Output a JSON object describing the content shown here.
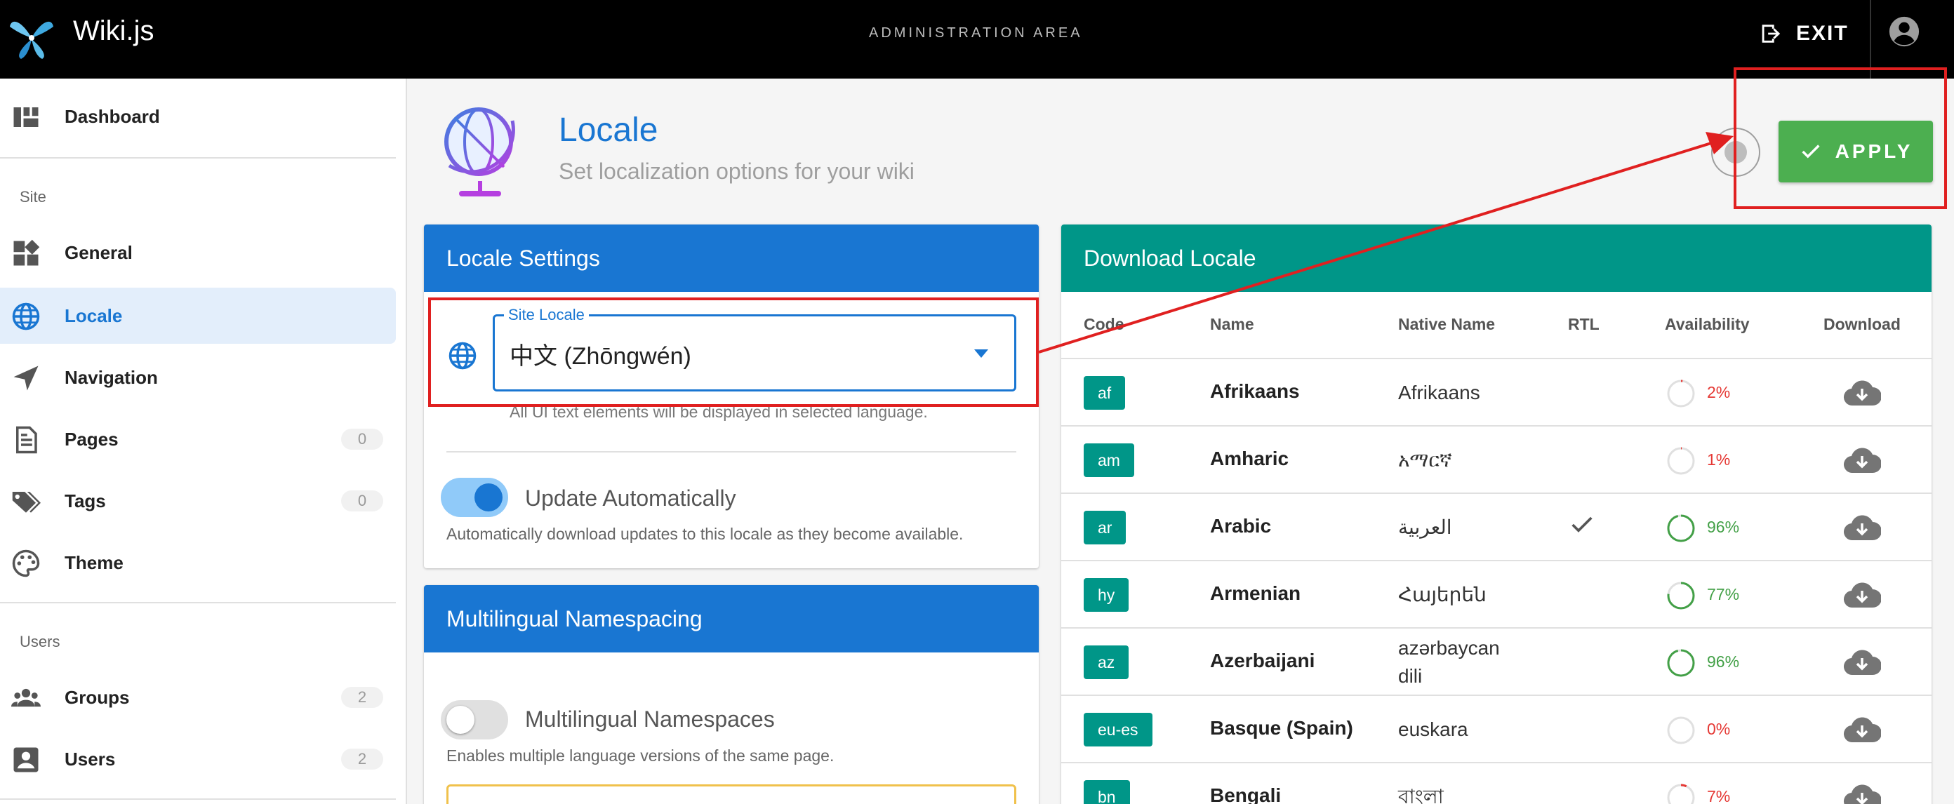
{
  "topbar": {
    "brand": "Wiki.js",
    "area": "ADMINISTRATION AREA",
    "exit_label": "EXIT"
  },
  "sidebar": {
    "dashboard": "Dashboard",
    "section_site": "Site",
    "general": "General",
    "locale": "Locale",
    "navigation": "Navigation",
    "pages": "Pages",
    "pages_count": "0",
    "tags": "Tags",
    "tags_count": "0",
    "theme": "Theme",
    "section_users": "Users",
    "groups": "Groups",
    "groups_count": "2",
    "users": "Users",
    "users_count": "2"
  },
  "header": {
    "title": "Locale",
    "subtitle": "Set localization options for your wiki",
    "apply_label": "APPLY"
  },
  "locale_settings": {
    "title": "Locale Settings",
    "site_locale_label": "Site Locale",
    "site_locale_value": "中文 (Zhōngwén)",
    "site_locale_hint": "All UI text elements will be displayed in selected language.",
    "update_label": "Update Automatically",
    "update_hint": "Automatically download updates to this locale as they become available."
  },
  "namespacing": {
    "title": "Multilingual Namespacing",
    "toggle_label": "Multilingual Namespaces",
    "toggle_hint": "Enables multiple language versions of the same page."
  },
  "download": {
    "title": "Download Locale",
    "columns": [
      "Code",
      "Name",
      "Native Name",
      "RTL",
      "Availability",
      "Download"
    ],
    "rows": [
      {
        "code": "af",
        "name": "Afrikaans",
        "native": "Afrikaans",
        "rtl": false,
        "availability": "2%",
        "level": 0.02
      },
      {
        "code": "am",
        "name": "Amharic",
        "native": "አማርኛ",
        "rtl": false,
        "availability": "1%",
        "level": 0.01
      },
      {
        "code": "ar",
        "name": "Arabic",
        "native": "العربية",
        "rtl": true,
        "availability": "96%",
        "level": 0.96
      },
      {
        "code": "hy",
        "name": "Armenian",
        "native": "Հայերեն",
        "rtl": false,
        "availability": "77%",
        "level": 0.77
      },
      {
        "code": "az",
        "name": "Azerbaijani",
        "native": "azərbaycan dili",
        "rtl": false,
        "availability": "96%",
        "level": 0.96
      },
      {
        "code": "eu-es",
        "name": "Basque (Spain)",
        "native": "euskara",
        "rtl": false,
        "availability": "0%",
        "level": 0.0
      },
      {
        "code": "bn",
        "name": "Bengali",
        "native": "বাংলা",
        "rtl": false,
        "availability": "7%",
        "level": 0.07
      }
    ]
  },
  "colors": {
    "primary": "#1976d2",
    "teal": "#009688",
    "apply_green": "#4caf50",
    "annotation_red": "#e02020",
    "avail_high": "#43a047",
    "avail_low": "#e53935"
  }
}
